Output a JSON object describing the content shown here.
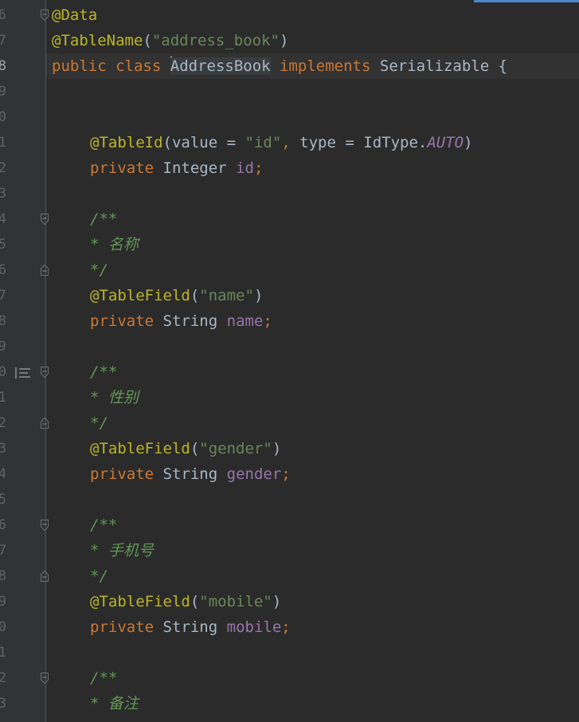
{
  "editor": {
    "line_numbers": [
      "6",
      "7",
      "8",
      "9",
      "0",
      "1",
      "2",
      "3",
      "4",
      "5",
      "6",
      "7",
      "8",
      "9",
      "0",
      "1",
      "2",
      "3",
      "4",
      "5",
      "6",
      "7",
      "8",
      "9",
      "0",
      "1",
      "2",
      "3"
    ],
    "lines": {
      "l6": {
        "annotation": "@Data"
      },
      "l7": {
        "annotation": "@TableName",
        "open": "(",
        "string": "\"address_book\"",
        "close": ")"
      },
      "l8": {
        "kw1": "public",
        "kw2": "class",
        "class_name": "AddressBook",
        "kw3": "implements",
        "interface": "Serializable",
        "brace": "{"
      },
      "l11": {
        "annotation": "@TableId",
        "open": "(",
        "param1": "value",
        "eq1": " = ",
        "string": "\"id\"",
        "comma": ",",
        "param2": "type",
        "eq2": " = ",
        "type_ref": "IdType.",
        "constant": "AUTO",
        "close": ")"
      },
      "l12": {
        "kw": "private",
        "type": "Integer",
        "field": "id",
        "semi": ";"
      },
      "l14": {
        "doc": "/**"
      },
      "l15": {
        "doc": "* 名称"
      },
      "l16": {
        "doc": "*/"
      },
      "l17": {
        "annotation": "@TableField",
        "open": "(",
        "string": "\"name\"",
        "close": ")"
      },
      "l18": {
        "kw": "private",
        "type": "String",
        "field": "name",
        "semi": ";"
      },
      "l20": {
        "doc": "/**"
      },
      "l21": {
        "doc": "* 性别"
      },
      "l22": {
        "doc": "*/"
      },
      "l23": {
        "annotation": "@TableField",
        "open": "(",
        "string": "\"gender\"",
        "close": ")"
      },
      "l24": {
        "kw": "private",
        "type": "String",
        "field": "gender",
        "semi": ";"
      },
      "l26": {
        "doc": "/**"
      },
      "l27": {
        "doc": "* 手机号"
      },
      "l28": {
        "doc": "*/"
      },
      "l29": {
        "annotation": "@TableField",
        "open": "(",
        "string": "\"mobile\"",
        "close": ")"
      },
      "l30": {
        "kw": "private",
        "type": "String",
        "field": "mobile",
        "semi": ";"
      },
      "l32": {
        "doc": "/**"
      },
      "l33": {
        "doc": "* 备注"
      }
    }
  },
  "icons": {
    "fold": "fold-marker-icon",
    "bookmark": "implementation-marker-icon"
  },
  "colors": {
    "background": "#2b2b2b",
    "gutter": "#313335",
    "annotation": "#bbb529",
    "keyword": "#cc7832",
    "string": "#6a8759",
    "field": "#9876aa",
    "doc_comment": "#629755",
    "plain": "#a9b7c6",
    "accent": "#4a88c7"
  }
}
